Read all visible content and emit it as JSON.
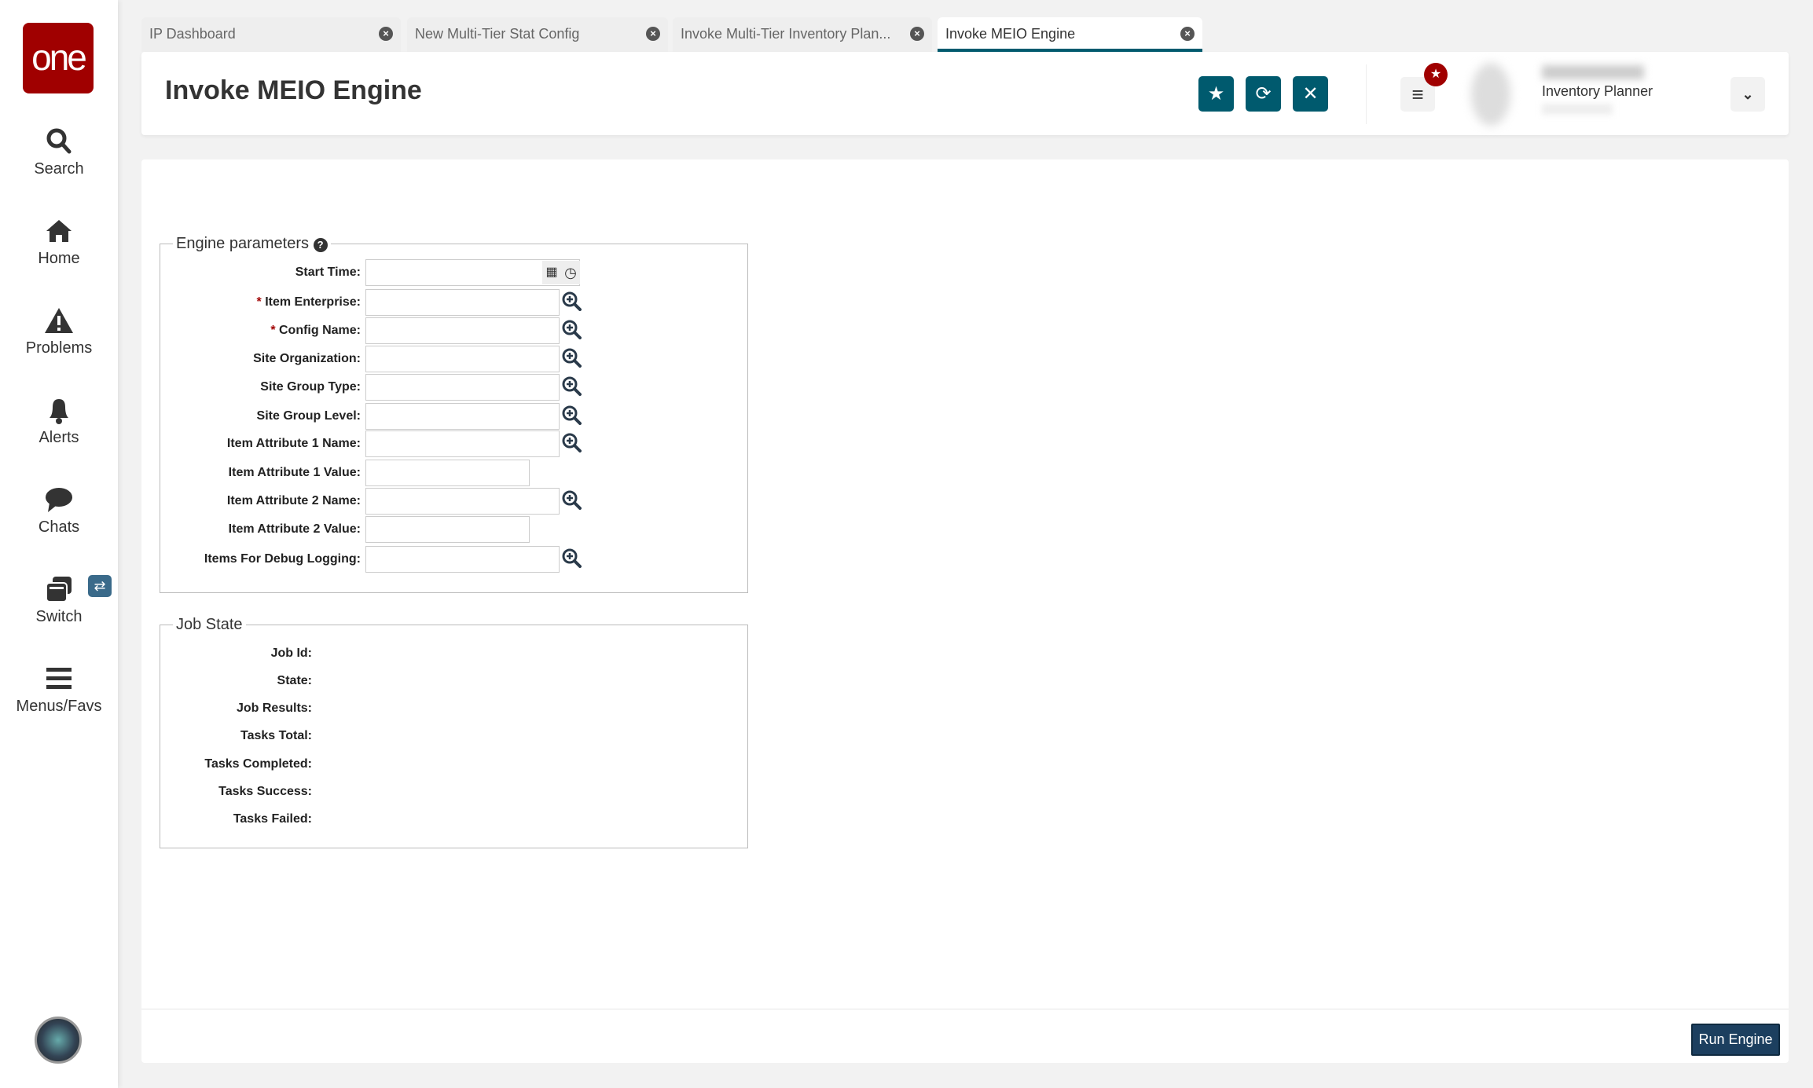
{
  "app": {
    "logo": "one"
  },
  "sidebar": {
    "items": [
      {
        "label": "Search",
        "icon": "search-icon"
      },
      {
        "label": "Home",
        "icon": "home-icon"
      },
      {
        "label": "Problems",
        "icon": "warning-icon"
      },
      {
        "label": "Alerts",
        "icon": "bell-icon"
      },
      {
        "label": "Chats",
        "icon": "chat-icon"
      },
      {
        "label": "Switch",
        "icon": "switch-icon"
      },
      {
        "label": "Menus/Favs",
        "icon": "menu-icon"
      }
    ]
  },
  "tabs": [
    {
      "label": "IP Dashboard"
    },
    {
      "label": "New Multi-Tier Stat Config"
    },
    {
      "label": "Invoke Multi-Tier Inventory Plan..."
    },
    {
      "label": "Invoke MEIO Engine",
      "active": true
    }
  ],
  "header": {
    "title": "Invoke MEIO Engine",
    "user_role": "Inventory Planner"
  },
  "engine_params": {
    "legend": "Engine parameters",
    "fields": [
      {
        "label": "Start Time:",
        "value": "",
        "required": false
      },
      {
        "label": "Item Enterprise:",
        "value": "",
        "required": true
      },
      {
        "label": "Config Name:",
        "value": "",
        "required": true
      },
      {
        "label": "Site Organization:",
        "value": ""
      },
      {
        "label": "Site Group Type:",
        "value": ""
      },
      {
        "label": "Site Group Level:",
        "value": ""
      },
      {
        "label": "Item Attribute 1 Name:",
        "value": ""
      },
      {
        "label": "Item Attribute 1 Value:",
        "value": ""
      },
      {
        "label": "Item Attribute 2 Name:",
        "value": ""
      },
      {
        "label": "Item Attribute 2 Value:",
        "value": ""
      },
      {
        "label": "Items For Debug Logging:",
        "value": ""
      }
    ]
  },
  "job_state": {
    "legend": "Job State",
    "labels": [
      "Job Id:",
      "State:",
      "Job Results:",
      "Tasks Total:",
      "Tasks Completed:",
      "Tasks Success:",
      "Tasks Failed:"
    ]
  },
  "footer": {
    "run_label": "Run Engine"
  },
  "colors": {
    "brand": "#a00000",
    "accent": "#005a6e",
    "run_button": "#1c3f5f"
  }
}
